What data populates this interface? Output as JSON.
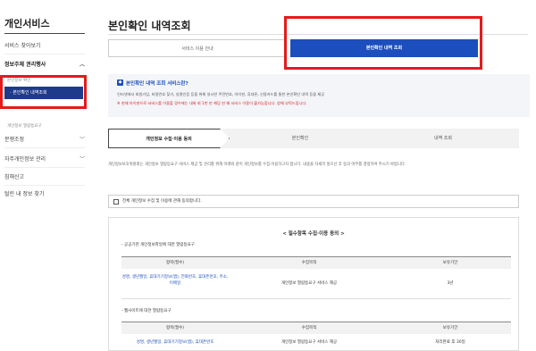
{
  "sidebar": {
    "title": "개인서비스",
    "items": [
      {
        "label": "서비스 찾아보기"
      },
      {
        "label": "정보주체 권리행사",
        "chevron": "chevron-up"
      },
      {
        "label": "본인정보 확인",
        "sub": true
      },
      {
        "label": "본인확인 내역조회",
        "active": true
      },
      {
        "label": "개인정보 열람등요구",
        "sub": true
      },
      {
        "label": "분쟁조정",
        "chevron": "chevron-down"
      },
      {
        "label": "자주개인정보 관리",
        "chevron": "chevron-down"
      },
      {
        "label": "침해신고"
      },
      {
        "label": "털린 내 정보 찾기"
      }
    ]
  },
  "main": {
    "title": "본인확인 내역조회",
    "tabs": [
      {
        "label": "서비스 이용 안내"
      },
      {
        "label": "본인확인 내역 조회"
      }
    ],
    "info": {
      "title": "본인확인 내역 조회 서비스란?",
      "text": "인터넷에서 회원가입, 비밀번호 찾기, 실명인증 등을 위해 실시한 주민번호, 아이핀, 휴대폰, 신용카드를 통한 본인확인 내역 등을 제공",
      "warning": "※ 현재 아이핀으로 서비스를 이용할 경우에는 내위 회 1번 만 해당 만 해 서비스 이용이 불가능합니다. 양해 부탁드립니다."
    },
    "steps": [
      "개인정보 수집·이용 동의",
      "본인확인",
      "내역 조회"
    ],
    "description": "개인정보보호위원회는 개인정보 열람등요구 서비스 제공 및 관리를 위해 아래와 같이 개인정보를 수집·이용하고자 합니다. 내용을 자세히 읽으신 후 동의 여부를 결정하여 주시기 바랍니다.",
    "consent_label": "전체 개인정보 수집 및 이용에 관해 동의합니다.",
    "terms": {
      "heading": "< 필수항목 수집·이용 동의 >",
      "sections": [
        {
          "title": "- 공공기관 개인정보파일에 대한 열람등요구",
          "headers": [
            "항목(필수)",
            "수집목적",
            "보유기간"
          ],
          "rows": [
            [
              "성명, 생년월일, 휴대기기정보(앱), 전화번호, 휴대폰번호, 주소, 이메일",
              "개인정보 열람등요구 서비스 제공",
              "3년"
            ]
          ]
        },
        {
          "title": "- 웹사이트에 대한 열람등요구",
          "headers": [
            "항목(필수)",
            "수집목적",
            "보유기간"
          ],
          "rows": [
            [
              "성명, 생년월일, 휴대기기정보(앱), 휴대폰번호",
              "개인정보 열람등요구 서비스 제공",
              "처리완료 후 30일"
            ]
          ]
        }
      ]
    }
  },
  "colors": {
    "accent": "#1d4ebd",
    "sidebar_active": "#1e3a8a",
    "highlight": "#e31b1b"
  }
}
